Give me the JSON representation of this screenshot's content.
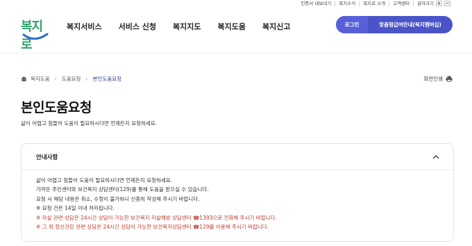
{
  "util_links": [
    "인증서 내보내기",
    "복지소식",
    "복지로 소개",
    "고객센터",
    "글자크기"
  ],
  "zoom_buttons": {
    "plus": "+",
    "minus": "−"
  },
  "logo": {
    "text": "복지로"
  },
  "gnb": [
    "복지서비스",
    "서비스 신청",
    "복지지도",
    "복지도움",
    "복지신고"
  ],
  "header_buttons": {
    "login": "로그인",
    "member": "맞춤형급여안내(복지멤버십)"
  },
  "breadcrumb": [
    "복지도움",
    "도움요청",
    "본인도움요청"
  ],
  "print_label": "화면인쇄",
  "page_title": "본인도움요청",
  "page_desc": "삶이 어렵고 힘들어 도움이 필요하시다면 언제든지 요청하세요.",
  "notice": {
    "heading": "안내사항",
    "lines": [
      "삶이 어렵고 힘들어 도움이 필요하시다면 언제든지 요청하세요.",
      "가까운 주민센터와 보건복지 상담센터(129)를 통해 도움을 받으실 수 있습니다.",
      "요청 시 해당 내용은 취소, 수정이 불가하니 신중히 작성해 주시기 바랍니다.",
      "※ 요청 건은 14일 이내 처리됩니다."
    ],
    "red_lines": [
      "※ 자살 관련 상담은 24시간 상담이 가능한 보건복지 자살예방 상담센터 ☎1393으로 전화해 주시기 바랍니다.",
      "※ 그 외 정신건강 관련 상담은 24시간 상담이 가능한 보건복지상담센터 ☎129를 이용해 주시기 바랍니다."
    ]
  },
  "colors": {
    "brand_green": "#2ea06a",
    "button_indigo": "#4a54c8",
    "breadcrumb_current": "#2b3a8c",
    "alert_red": "#c0392b"
  },
  "icons": [
    "home-icon",
    "chevron-right-icon",
    "printer-icon",
    "chevron-up-icon"
  ]
}
